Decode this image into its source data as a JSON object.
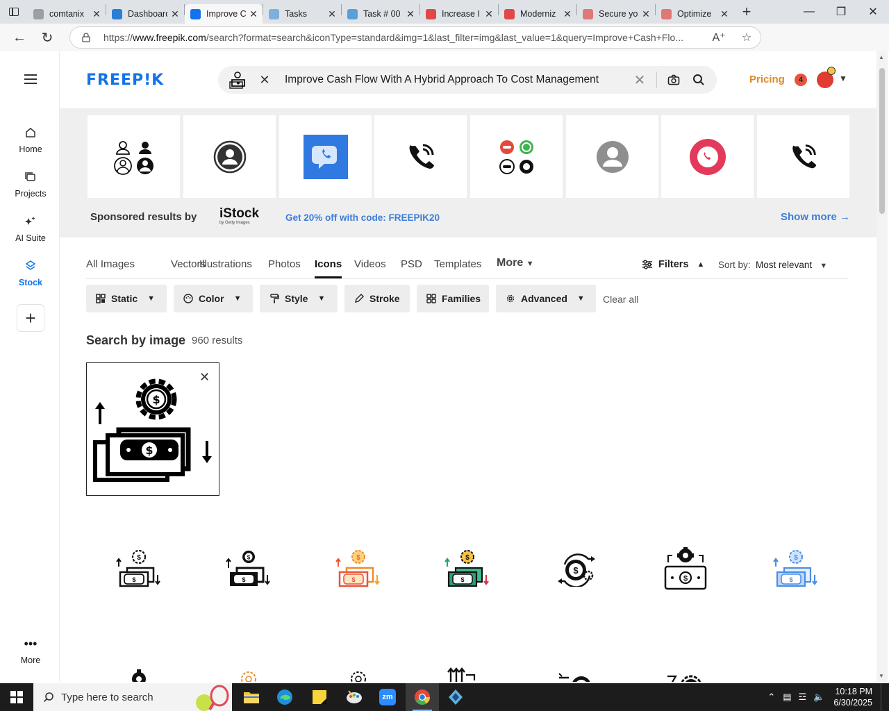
{
  "browser": {
    "tabs": [
      {
        "label": "comtanix",
        "color": "#9aa0a6"
      },
      {
        "label": "Dashboard",
        "color": "#2a7fd4"
      },
      {
        "label": "Improve C",
        "color": "#1273eb",
        "active": true
      },
      {
        "label": "Tasks",
        "color": "#7fb0d9"
      },
      {
        "label": "Task # 00",
        "color": "#5aa0d8"
      },
      {
        "label": "Increase I",
        "color": "#e04848"
      },
      {
        "label": "Moderniz",
        "color": "#e04848"
      },
      {
        "label": "Secure yo",
        "color": "#e07878"
      },
      {
        "label": "Optimize",
        "color": "#e07878"
      }
    ],
    "url_prefix": "https://",
    "url_domain": "www.freepik.com",
    "url_rest": "/search?format=search&iconType=standard&img=1&last_filter=img&last_value=1&query=Improve+Cash+Flo..."
  },
  "sidebar": {
    "items": [
      {
        "label": "Home",
        "icon": "home-icon"
      },
      {
        "label": "Projects",
        "icon": "projects-icon"
      },
      {
        "label": "AI Suite",
        "icon": "sparkle-icon"
      },
      {
        "label": "Stock",
        "icon": "stock-icon"
      }
    ],
    "more_label": "More"
  },
  "header": {
    "logo": "FREEP!K",
    "query": "Improve Cash Flow With A Hybrid Approach To Cost Management",
    "pricing": "Pricing",
    "notifications": "4"
  },
  "sponsored": {
    "label": "Sponsored results by",
    "brand": "iStock",
    "brand_sub": "by Getty Images",
    "promo": "Get 20% off with code: FREEPIK20",
    "show_more": "Show more →"
  },
  "type_tabs": [
    "All Images",
    "Vectors",
    "Illustrations",
    "Photos",
    "Icons",
    "Videos",
    "PSD",
    "Templates",
    "More"
  ],
  "toolbar": {
    "filters": "Filters",
    "sort_label": "Sort by:",
    "sort_value": "Most relevant"
  },
  "filter_chips": [
    "Static",
    "Color",
    "Style",
    "Stroke",
    "Families",
    "Advanced"
  ],
  "clear_all": "Clear all",
  "results": {
    "title": "Search by image",
    "count": "960 results"
  },
  "taskbar": {
    "search_placeholder": "Type here to search",
    "time": "10:18 PM",
    "date": "6/30/2025"
  }
}
